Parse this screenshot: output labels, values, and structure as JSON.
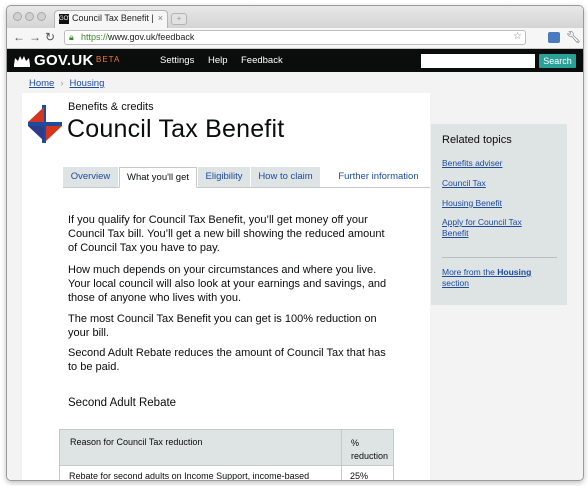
{
  "browser": {
    "tab_title": "Council Tax Benefit | Housi",
    "tab_close": "×",
    "favicon_text": "GOV",
    "url_scheme": "https://",
    "url_rest": "www.gov.uk/feedback"
  },
  "header": {
    "logo": "GOV.UK",
    "beta": "BETA",
    "nav": [
      "Settings",
      "Help",
      "Feedback"
    ],
    "search_placeholder": "",
    "search_button": "Search"
  },
  "breadcrumb": [
    "Home",
    "Housing"
  ],
  "page": {
    "supertitle": "Benefits & credits",
    "title": "Council Tax Benefit",
    "tabs": [
      "Overview",
      "What you'll get",
      "Eligibility",
      "How to claim",
      "Further information"
    ],
    "active_tab": "What you'll get",
    "paragraphs": [
      "If you qualify for Council Tax Benefit, you’ll get money off your Council Tax bill. You’ll get a new bill showing the reduced amount of Council Tax you have to pay.",
      "How much depends on your circumstances and where you live. Your local council will also look at your earnings and savings, and those of anyone who lives with you.",
      "The most Council Tax Benefit you can get is 100% reduction on your bill.",
      "Second Adult Rebate reduces the amount of Council Tax that has to be paid."
    ],
    "subheading": "Second Adult Rebate",
    "table": {
      "headers": [
        "Reason for Council Tax reduction",
        "% reduction"
      ],
      "rows": [
        [
          "Rebate for second adults on Income Support, income-based",
          "25%"
        ]
      ]
    }
  },
  "related": {
    "heading": "Related topics",
    "links": [
      "Benefits adviser",
      "Council Tax",
      "Housing Benefit",
      "Apply for Council Tax Benefit"
    ],
    "more_prefix": "More from the ",
    "more_bold": "Housing",
    "more_suffix": "section"
  },
  "colors": {
    "header_bg": "#0b0c0c",
    "beta": "#f47738",
    "search_button": "#2aa198",
    "link": "#1d4ba0",
    "tab_bg": "#dee3e3"
  }
}
